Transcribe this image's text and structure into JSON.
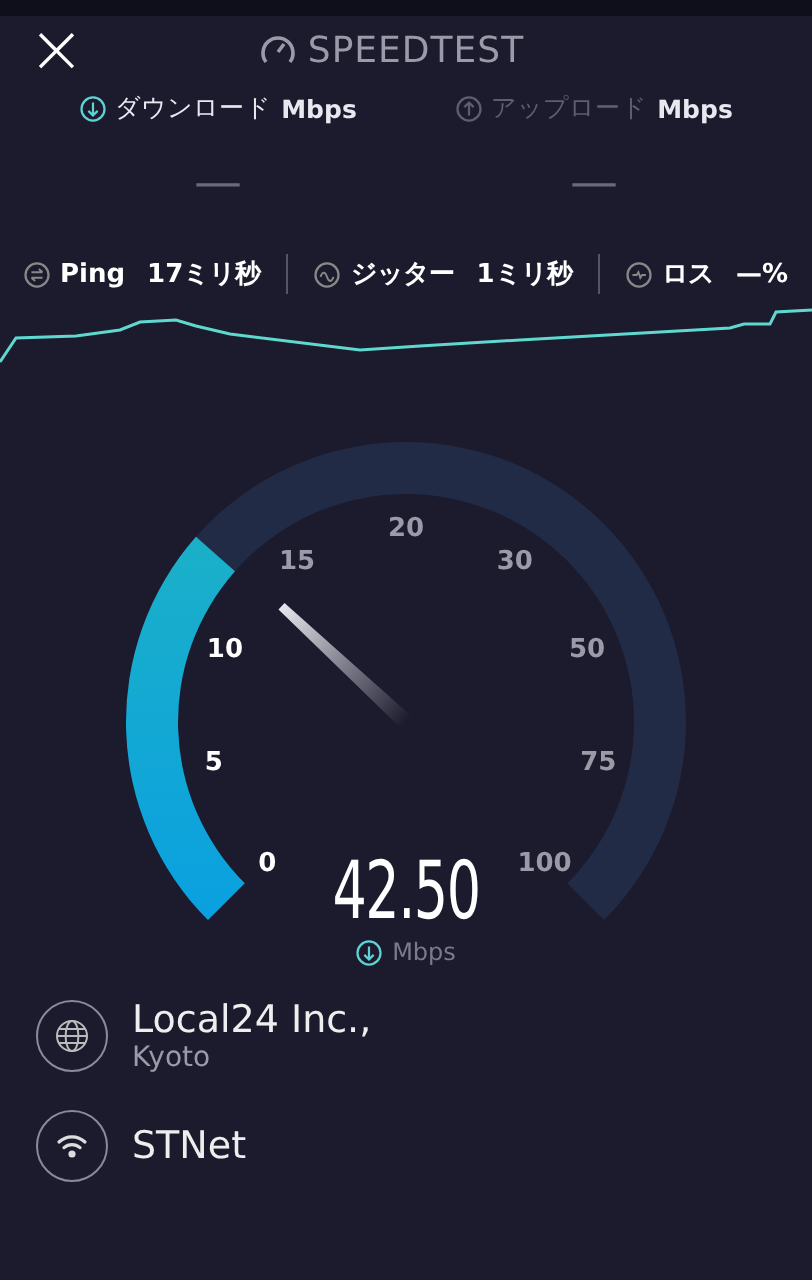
{
  "header": {
    "close": "×",
    "title": "SPEEDTEST"
  },
  "results": [
    {
      "kind": "download",
      "label": "ダウンロード",
      "unit": "Mbps",
      "value": "—",
      "selected": true
    },
    {
      "kind": "upload",
      "label": "アップロード",
      "unit": "Mbps",
      "value": "—",
      "selected": false
    }
  ],
  "stats": [
    {
      "kind": "ping",
      "label": "Ping",
      "value": "17ミリ秒"
    },
    {
      "kind": "jitter",
      "label": "ジッター",
      "value": "1ミリ秒"
    },
    {
      "kind": "loss",
      "label": "ロス",
      "value": "—%"
    }
  ],
  "gauge": {
    "ticks": [
      "0",
      "5",
      "10",
      "15",
      "20",
      "30",
      "50",
      "75",
      "100"
    ],
    "reading": "42.50",
    "unit": "Mbps"
  },
  "server": {
    "name": "Local24 Inc.,",
    "location": "Kyoto"
  },
  "network": {
    "name": "STNet"
  }
}
